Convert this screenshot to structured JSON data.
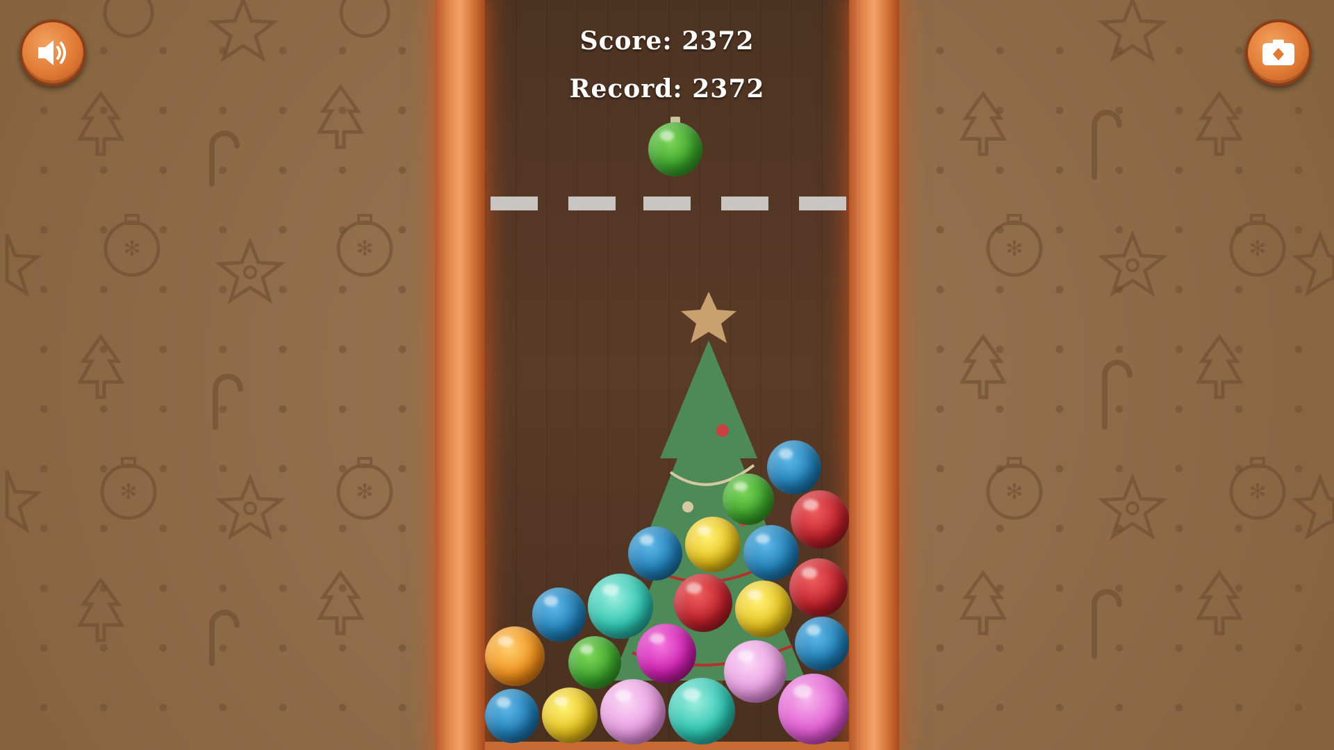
{
  "hud": {
    "score_text": "Score: 2372",
    "record_text": "Record: 2372"
  },
  "buttons": {
    "sound_icon": "speaker-icon",
    "camera_icon": "camera-icon"
  },
  "colors": {
    "frame": "#e48a4e",
    "board": "#543826",
    "wallpaper": "#8a6a48",
    "limit_line": "#c9c5c3"
  },
  "next_ornament": {
    "color": "green",
    "hex": "#3aa52a"
  },
  "ornaments": [
    {
      "color": "blue",
      "hex": "#1f7fb8"
    },
    {
      "color": "green",
      "hex": "#3aa52a"
    },
    {
      "color": "red",
      "hex": "#c0202a"
    },
    {
      "color": "yellow",
      "hex": "#e8c21a"
    },
    {
      "color": "blue",
      "hex": "#1f7fb8"
    },
    {
      "color": "blue",
      "hex": "#1f7fb8"
    },
    {
      "color": "red",
      "hex": "#c0202a"
    },
    {
      "color": "blue",
      "hex": "#1f7fb8"
    },
    {
      "color": "teal",
      "hex": "#2cc3b0"
    },
    {
      "color": "red",
      "hex": "#c0202a"
    },
    {
      "color": "yellow",
      "hex": "#e8c21a"
    },
    {
      "color": "orange",
      "hex": "#f0901a"
    },
    {
      "color": "green",
      "hex": "#3aa52a"
    },
    {
      "color": "magenta",
      "hex": "#d01fb0"
    },
    {
      "color": "pink",
      "hex": "#e89ae0"
    },
    {
      "color": "blue",
      "hex": "#1f7fb8"
    },
    {
      "color": "blue",
      "hex": "#1f7fb8"
    },
    {
      "color": "yellow",
      "hex": "#e8c21a"
    },
    {
      "color": "pink",
      "hex": "#e89ae0"
    },
    {
      "color": "teal",
      "hex": "#2cc3b0"
    },
    {
      "color": "magenta",
      "hex": "#e05ad0"
    }
  ]
}
